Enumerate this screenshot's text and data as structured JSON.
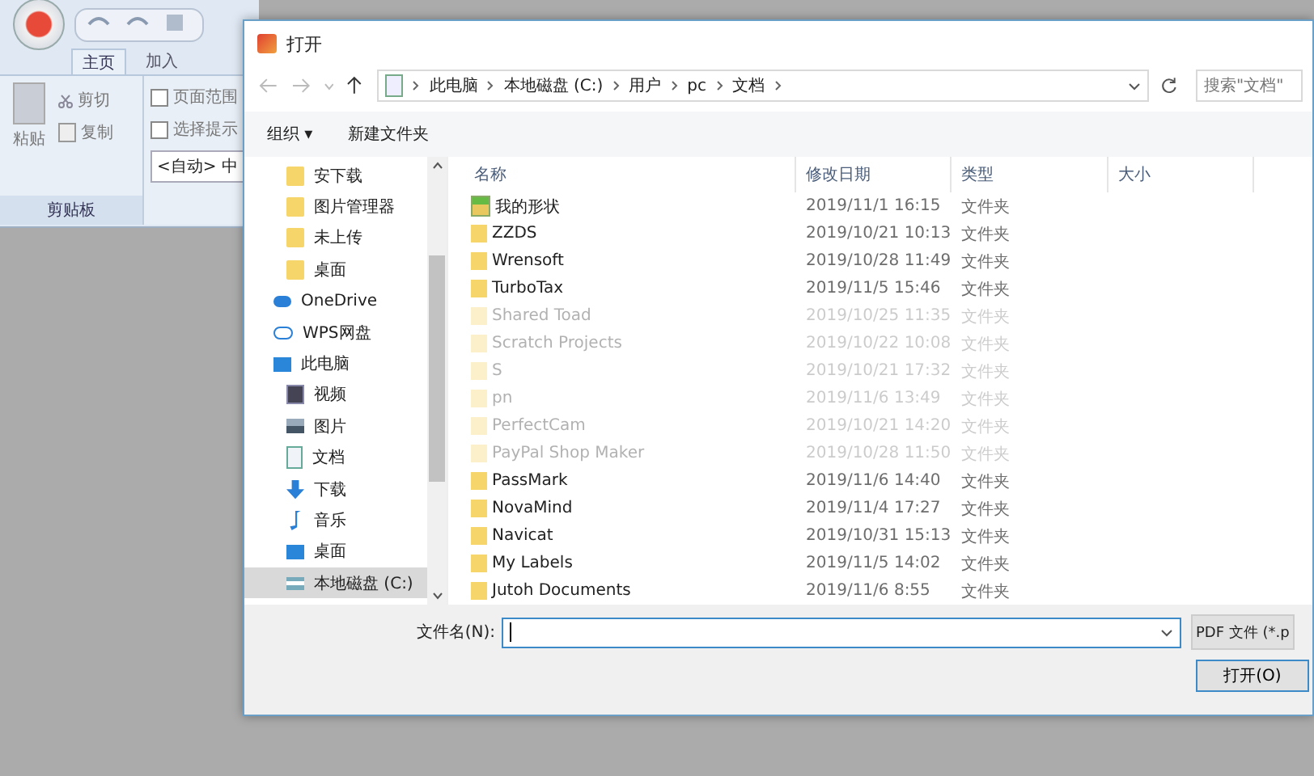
{
  "app": {
    "tabs": [
      {
        "label": "主页",
        "selected": true
      },
      {
        "label": "加入",
        "selected": false
      }
    ],
    "clipboard": {
      "paste": "粘贴",
      "cut": "剪切",
      "copy": "复制",
      "group_label": "剪贴板"
    },
    "options": [
      {
        "label": "页面范围",
        "checked": false
      },
      {
        "label": "选择提示",
        "checked": false
      }
    ],
    "dropdown": "<自动> 中"
  },
  "dialog": {
    "title": "打开",
    "path": [
      "此电脑",
      "本地磁盘 (C:)",
      "用户",
      "pc",
      "文档"
    ],
    "search": {
      "placeholder": "搜索\"文档\""
    },
    "toolbar": {
      "organize": "组织 ▾",
      "new_folder": "新建文件夹"
    },
    "nav": [
      {
        "label": "安下载",
        "kind": "folder",
        "selected": false
      },
      {
        "label": "图片管理器",
        "kind": "folder",
        "selected": false
      },
      {
        "label": "未上传",
        "kind": "folder",
        "selected": false
      },
      {
        "label": "桌面",
        "kind": "folder",
        "selected": false
      },
      {
        "label": "OneDrive",
        "kind": "cloud",
        "selected": false
      },
      {
        "label": "WPS网盘",
        "kind": "cloud-outline",
        "selected": false
      },
      {
        "label": "此电脑",
        "kind": "pc",
        "selected": false
      },
      {
        "label": "视频",
        "kind": "video",
        "selected": false
      },
      {
        "label": "图片",
        "kind": "image",
        "selected": false
      },
      {
        "label": "文档",
        "kind": "doc",
        "selected": false
      },
      {
        "label": "下载",
        "kind": "download",
        "selected": false
      },
      {
        "label": "音乐",
        "kind": "music",
        "selected": false
      },
      {
        "label": "桌面",
        "kind": "desktop",
        "selected": false
      },
      {
        "label": "本地磁盘 (C:)",
        "kind": "drive",
        "selected": true
      }
    ],
    "columns": [
      "名称",
      "修改日期",
      "类型",
      "大小"
    ],
    "rows": [
      {
        "name": "我的形状",
        "date": "2019/11/1 16:15",
        "type": "文件夹",
        "kind": "special",
        "faded": false
      },
      {
        "name": "ZZDS",
        "date": "2019/10/21 10:13",
        "type": "文件夹",
        "kind": "folder",
        "faded": false
      },
      {
        "name": "Wrensoft",
        "date": "2019/10/28 11:49",
        "type": "文件夹",
        "kind": "folder",
        "faded": false
      },
      {
        "name": "TurboTax",
        "date": "2019/11/5 15:46",
        "type": "文件夹",
        "kind": "folder",
        "faded": false
      },
      {
        "name": "Shared Toad",
        "date": "2019/10/25 11:35",
        "type": "文件夹",
        "kind": "folder",
        "faded": true
      },
      {
        "name": "Scratch Projects",
        "date": "2019/10/22 10:08",
        "type": "文件夹",
        "kind": "folder",
        "faded": true
      },
      {
        "name": "S",
        "date": "2019/10/21 17:32",
        "type": "文件夹",
        "kind": "folder",
        "faded": true
      },
      {
        "name": "pn",
        "date": "2019/11/6 13:49",
        "type": "文件夹",
        "kind": "folder",
        "faded": true
      },
      {
        "name": "PerfectCam",
        "date": "2019/10/21 14:20",
        "type": "文件夹",
        "kind": "folder",
        "faded": true
      },
      {
        "name": "PayPal Shop Maker",
        "date": "2019/10/28 11:50",
        "type": "文件夹",
        "kind": "folder",
        "faded": true
      },
      {
        "name": "PassMark",
        "date": "2019/11/6 14:40",
        "type": "文件夹",
        "kind": "folder",
        "faded": false
      },
      {
        "name": "NovaMind",
        "date": "2019/11/4 17:27",
        "type": "文件夹",
        "kind": "folder",
        "faded": false
      },
      {
        "name": "Navicat",
        "date": "2019/10/31 15:13",
        "type": "文件夹",
        "kind": "folder",
        "faded": false
      },
      {
        "name": "My Labels",
        "date": "2019/11/5 14:02",
        "type": "文件夹",
        "kind": "folder",
        "faded": false
      },
      {
        "name": "Jutoh Documents",
        "date": "2019/11/6 8:55",
        "type": "文件夹",
        "kind": "folder",
        "faded": false
      }
    ],
    "filename_label": "文件名(N):",
    "filetype": "PDF 文件 (*.p",
    "open_button": "打开(O)"
  }
}
